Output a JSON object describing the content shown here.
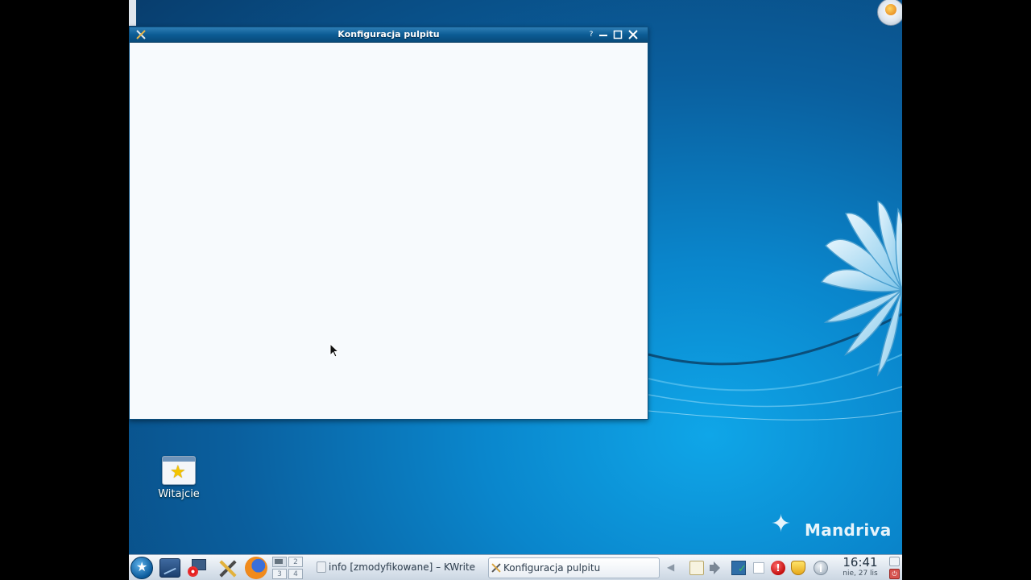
{
  "window": {
    "title": "Konfiguracja pulpitu",
    "help_label": "?"
  },
  "desktop": {
    "icons": [
      {
        "label": "Witajcie",
        "icon": "star-welcome-icon"
      }
    ],
    "branding": "Mandriva"
  },
  "taskbar": {
    "start_icon": "star-launcher-icon",
    "quick_launch": [
      "show-desktop-icon",
      "computer-icon",
      "configure-tools-icon",
      "firefox-icon"
    ],
    "pager": {
      "desktops": [
        "1",
        "2",
        "3",
        "4"
      ],
      "active": "1"
    },
    "tasks": [
      {
        "label": "info [zmodyfikowane] – KWrite",
        "icon": "document-icon",
        "active": false
      },
      {
        "label": "Konfiguracja pulpitu",
        "icon": "configure-tools-icon",
        "active": true
      }
    ],
    "tray_icons": [
      "expand-arrow-icon",
      "clipboard-icon",
      "volume-icon",
      "network-icon",
      "empty-box-icon",
      "alert-icon",
      "shield-icon",
      "info-icon"
    ],
    "clock": {
      "time": "16:41",
      "date": "nie, 27 lis"
    },
    "alert_glyph": "!",
    "info_glyph": "i"
  },
  "colors": {
    "titlebar": "#0c5c94",
    "desktop_accent": "#0a86cc",
    "window_bg": "#f7fafd"
  }
}
